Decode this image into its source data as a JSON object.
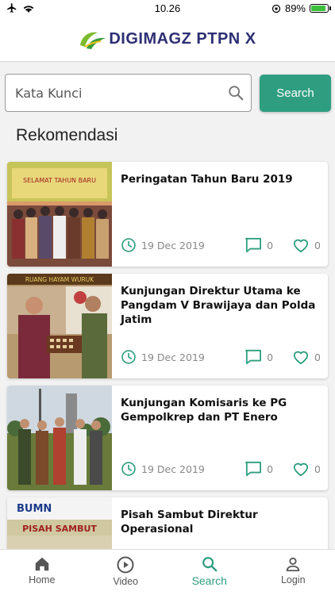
{
  "status_bar": {
    "time": "10.26",
    "battery_percent": "89%",
    "battery_level": 0.89
  },
  "header": {
    "brand": "DIGIMAGZ PTPN X"
  },
  "search": {
    "placeholder": "Kata Kunci",
    "button_label": "Search"
  },
  "section": {
    "title": "Rekomendasi"
  },
  "articles": [
    {
      "title": "Peringatan Tahun Baru 2019",
      "date": "19 Dec 2019",
      "comments": "0",
      "likes": "0",
      "thumb_caption": "SELAMAT TAHUN BARU"
    },
    {
      "title": "Kunjungan Direktur Utama ke Pangdam V Brawijaya dan Polda Jatim",
      "date": "19 Dec 2019",
      "comments": "0",
      "likes": "0",
      "thumb_caption": "RUANG HAYAM WURUK"
    },
    {
      "title": "Kunjungan Komisaris ke PG Gempolkrep dan PT Enero",
      "date": "19 Dec 2019",
      "comments": "0",
      "likes": "0",
      "thumb_caption": ""
    },
    {
      "title": "Pisah Sambut Direktur Operasional",
      "date": "",
      "comments": "",
      "likes": "",
      "thumb_caption": "PISAH SAMBUT"
    }
  ],
  "tabs": [
    {
      "label": "Home",
      "icon": "home-icon"
    },
    {
      "label": "Video",
      "icon": "play-circle-icon"
    },
    {
      "label": "Search",
      "icon": "search-icon"
    },
    {
      "label": "Login",
      "icon": "person-icon"
    }
  ],
  "colors": {
    "accent": "#2f9e80",
    "brand_text": "#2d2f74",
    "meta_text": "#888888"
  }
}
